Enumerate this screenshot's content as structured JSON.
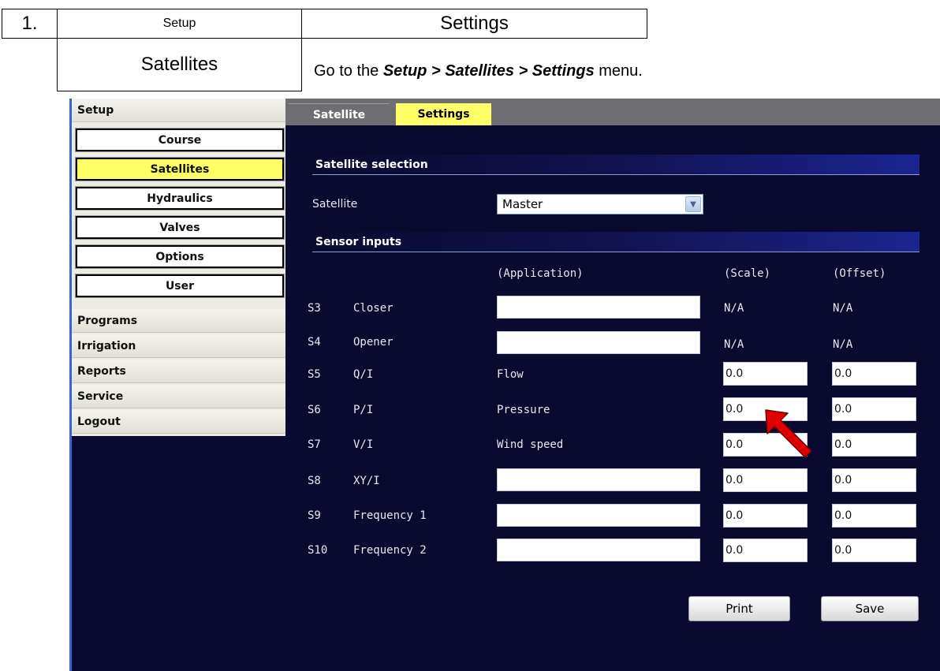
{
  "doc": {
    "step_number": "1.",
    "crumb_setup": "Setup",
    "crumb_settings": "Settings",
    "crumb_satellites": "Satellites",
    "instruction_prefix": "Go to the ",
    "instruction_path": "Setup > Satellites > Settings",
    "instruction_suffix": " menu."
  },
  "sidebar": {
    "header": "Setup",
    "items": [
      {
        "label": "Course",
        "active": false
      },
      {
        "label": "Satellites",
        "active": true
      },
      {
        "label": "Hydraulics",
        "active": false
      },
      {
        "label": "Valves",
        "active": false
      },
      {
        "label": "Options",
        "active": false
      },
      {
        "label": "User",
        "active": false
      }
    ],
    "menus": [
      "Programs",
      "Irrigation",
      "Reports",
      "Service",
      "Logout"
    ]
  },
  "tabs": [
    {
      "label": "Satellite",
      "active": false
    },
    {
      "label": "Settings",
      "active": true
    }
  ],
  "satellite_section": {
    "title": "Satellite selection",
    "field_label": "Satellite",
    "selected": "Master"
  },
  "sensor_section": {
    "title": "Sensor inputs",
    "col_application": "(Application)",
    "col_scale": "(Scale)",
    "col_offset": "(Offset)",
    "rows": [
      {
        "id": "S3",
        "name": "Closer",
        "application": "",
        "app_editable": true,
        "scale": "N/A",
        "offset": "N/A",
        "scale_editable": false
      },
      {
        "id": "S4",
        "name": "Opener",
        "application": "",
        "app_editable": true,
        "scale": "N/A",
        "offset": "N/A",
        "scale_editable": false
      },
      {
        "id": "S5",
        "name": "Q/I",
        "application": "Flow",
        "app_editable": false,
        "scale": "0.0",
        "offset": "0.0",
        "scale_editable": true
      },
      {
        "id": "S6",
        "name": "P/I",
        "application": "Pressure",
        "app_editable": false,
        "scale": "0.0",
        "offset": "0.0",
        "scale_editable": true
      },
      {
        "id": "S7",
        "name": "V/I",
        "application": "Wind speed",
        "app_editable": false,
        "scale": "0.0",
        "offset": "0.0",
        "scale_editable": true
      },
      {
        "id": "S8",
        "name": "XY/I",
        "application": "",
        "app_editable": true,
        "scale": "0.0",
        "offset": "0.0",
        "scale_editable": true
      },
      {
        "id": "S9",
        "name": "Frequency 1",
        "application": "",
        "app_editable": true,
        "scale": "0.0",
        "offset": "0.0",
        "scale_editable": true
      },
      {
        "id": "S10",
        "name": "Frequency 2",
        "application": "",
        "app_editable": true,
        "scale": "0.0",
        "offset": "0.0",
        "scale_editable": true
      }
    ]
  },
  "buttons": {
    "print": "Print",
    "save": "Save"
  },
  "colors": {
    "active_highlight": "#ffff66",
    "app_background": "#0a0a30",
    "pointer_arrow": "#e00000"
  }
}
